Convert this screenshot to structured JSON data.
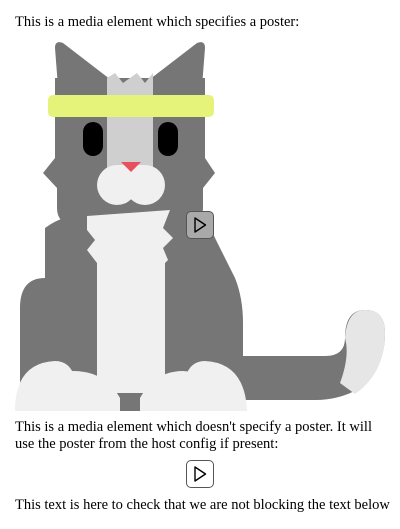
{
  "texts": {
    "poster_caption": "This is a media element which specifies a poster:",
    "no_poster_caption": "This is a media element which doesn't specify a poster. It will use the poster from the host config if present:",
    "footer_text": "This text is here to check that we are not blocking the text below"
  },
  "colors": {
    "cat_body": "#767676",
    "cat_light": "#f0f0f0",
    "headband": "#e5f37a",
    "nose": "#e8505b",
    "tail_tip": "#e6e6e6",
    "play_button_with_poster": "#a9a9a9",
    "play_button_without_poster": "#ffffff"
  },
  "icons": {
    "play_button_1": "play-icon",
    "play_button_2": "play-icon"
  }
}
